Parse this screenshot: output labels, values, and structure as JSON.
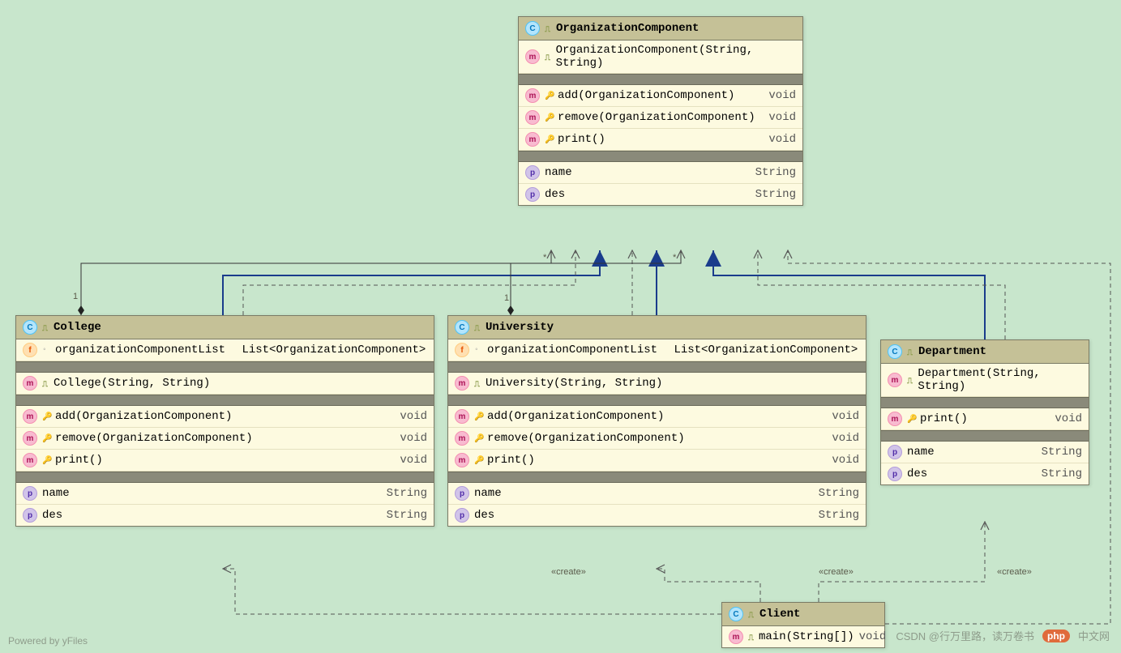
{
  "diagram": {
    "background": "#c8e6cc",
    "footer_powered": "Powered by yFiles",
    "footer_credit_prefix": "CSDN @行万里路，读万卷书",
    "php_badge": "php",
    "php_suffix": "中文网"
  },
  "labels": {
    "mult_star_a": "*",
    "mult_star_b": "*",
    "mult_one_a": "1",
    "mult_one_b": "1",
    "create_a": "«create»",
    "create_b": "«create»",
    "create_c": "«create»"
  },
  "classes": {
    "organizationComponent": {
      "name": "OrganizationComponent",
      "constructors": [
        {
          "sig": "OrganizationComponent(String, String)",
          "ret": ""
        }
      ],
      "methods": [
        {
          "sig": "add(OrganizationComponent)",
          "ret": "void"
        },
        {
          "sig": "remove(OrganizationComponent)",
          "ret": "void"
        },
        {
          "sig": "print()",
          "ret": "void"
        }
      ],
      "properties": [
        {
          "name": "name",
          "type": "String"
        },
        {
          "name": "des",
          "type": "String"
        }
      ]
    },
    "college": {
      "name": "College",
      "fields": [
        {
          "name": "organizationComponentList",
          "type": "List<OrganizationComponent>"
        }
      ],
      "constructors": [
        {
          "sig": "College(String, String)",
          "ret": ""
        }
      ],
      "methods": [
        {
          "sig": "add(OrganizationComponent)",
          "ret": "void"
        },
        {
          "sig": "remove(OrganizationComponent)",
          "ret": "void"
        },
        {
          "sig": "print()",
          "ret": "void"
        }
      ],
      "properties": [
        {
          "name": "name",
          "type": "String"
        },
        {
          "name": "des",
          "type": "String"
        }
      ]
    },
    "university": {
      "name": "University",
      "fields": [
        {
          "name": "organizationComponentList",
          "type": "List<OrganizationComponent>"
        }
      ],
      "constructors": [
        {
          "sig": "University(String, String)",
          "ret": ""
        }
      ],
      "methods": [
        {
          "sig": "add(OrganizationComponent)",
          "ret": "void"
        },
        {
          "sig": "remove(OrganizationComponent)",
          "ret": "void"
        },
        {
          "sig": "print()",
          "ret": "void"
        }
      ],
      "properties": [
        {
          "name": "name",
          "type": "String"
        },
        {
          "name": "des",
          "type": "String"
        }
      ]
    },
    "department": {
      "name": "Department",
      "constructors": [
        {
          "sig": "Department(String, String)",
          "ret": ""
        }
      ],
      "methods": [
        {
          "sig": "print()",
          "ret": "void"
        }
      ],
      "properties": [
        {
          "name": "name",
          "type": "String"
        },
        {
          "name": "des",
          "type": "String"
        }
      ]
    },
    "client": {
      "name": "Client",
      "methods": [
        {
          "sig": "main(String[])",
          "ret": "void"
        }
      ]
    }
  }
}
